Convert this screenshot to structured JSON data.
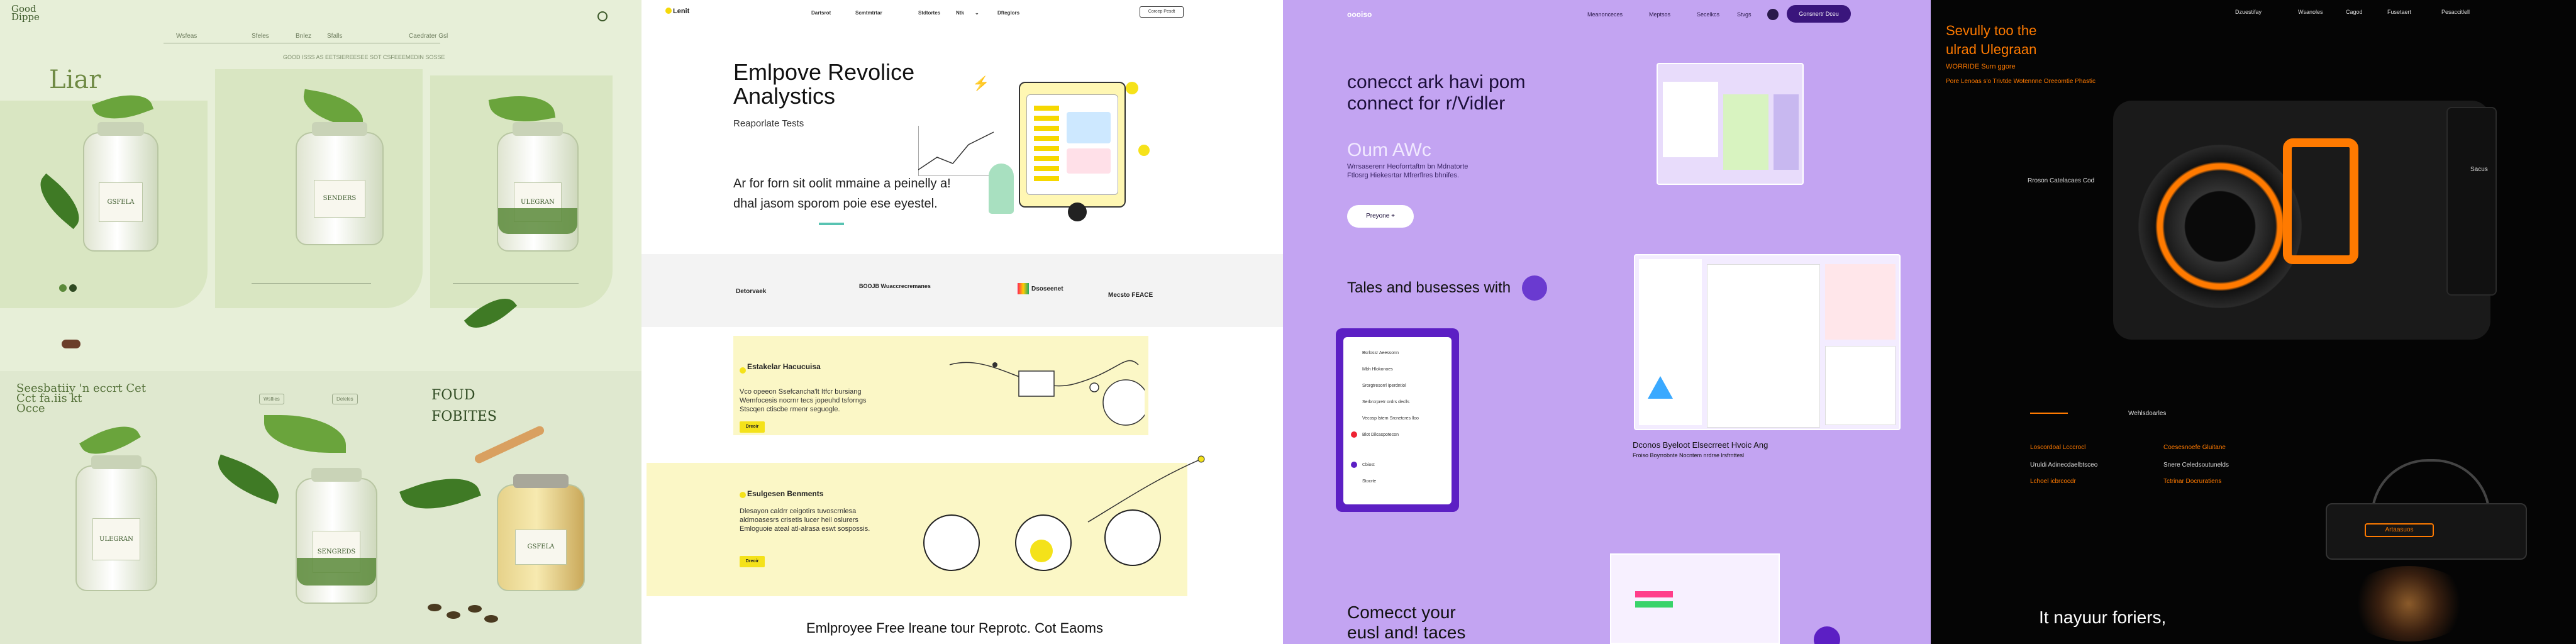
{
  "panel1": {
    "logo": [
      "Good",
      "Dippe"
    ],
    "nav": [
      "Wsfeas",
      "Sfeles",
      "Bnlez",
      "Sfalls",
      "Caedrater Gsl"
    ],
    "tagline": "GOOD ISSS AS EETSIEREESEE SOT CSFEEEMEDIN SOSSE",
    "hero_title": "Liar",
    "jar_labels": [
      "GSFELA",
      "SENDERS",
      "ULEGRAN",
      "SENGREDS"
    ],
    "mid_title": [
      "Seesbatiiy 'n eccrt Cet",
      "Cct fa.iis kt",
      "Occe"
    ],
    "found_title": [
      "FOUD",
      "FOBITES"
    ],
    "pills": [
      "Wsflies",
      "Deleles"
    ]
  },
  "panel2": {
    "brand": "Lenit",
    "nav": [
      "Dartsrot",
      "Scmtmtrtar",
      "Stdtortes",
      "Ntk",
      "Dfteglors"
    ],
    "nav_cta": "Corcep Pesdt",
    "hero_title": [
      "Emlpove Revolice",
      "Analystics"
    ],
    "hero_sub": "Reaporlate Tests",
    "hero_lead": [
      "Ar for forn sit oolit mmaine a peinelly a!",
      "dhal jasom sporom poie ese eyestel."
    ],
    "logos": [
      "Detorvaek",
      "BOOJB Wuaccrecremanes",
      "Dsoseenet",
      "Mecsto FEACE"
    ],
    "feature1": {
      "title": "Estakelar Hacucuisa",
      "text": [
        "Vco opeeon Ssefcancha'lt Itfcr bursiang",
        "Wemfocesis nocrnr tecs jopeuhd tsforngs",
        "Stscqen ctiscbe rmenr seguogle."
      ],
      "button": "Dreoir"
    },
    "feature2": {
      "title": "Esulgesen Benments",
      "text": [
        "Dlesayon caldrr ceigotirs tuvoscrnlesa",
        "aldmoasesrs crisetis lucer heil oslurers",
        "Emloguoie ateal atl-alrasa eswt sospossis."
      ],
      "button": "Dreoir"
    },
    "footer_title": "Emlproyee Free lreane tour Reprotc. Cot Eaoms"
  },
  "panel3": {
    "brand": "oooiso",
    "nav": [
      "Meanonceces",
      "Meptsos",
      "Secelkcs",
      "Stvgs"
    ],
    "cta": "Gonsnertr Dceu",
    "hero_title": [
      "conecct ark havi pom",
      "connect for r/Vidler"
    ],
    "hero_sub": "Oum AWc",
    "hero_small": [
      "Wrrsaserenr Heoforrtaftm bn Mdnatorte",
      "Ftlosrg Hiekesrtar Mfrerflres bhnifes."
    ],
    "hero_button": "Preyone +",
    "section_title": "Tales and busesses with",
    "phone_rows": [
      "Bsrlossr Aeessonn",
      "Mbh Hlokonoes",
      "Srorgtresorrl Iperdntiol",
      "Serbrcrpretr ordrs declls",
      "Vecosp lstem Srcnetcres lloo",
      "Blot Dilcaspotecon",
      "Cbiost",
      "Stocrte"
    ],
    "caption": [
      "Dconos Byeloot Elsecrreet Hvoic Ang",
      "Froiso Boyrrobnte Nocntem nrdrse lrsfrnttesl"
    ],
    "bottom_title": [
      "Comecct your",
      "eusl and! taces"
    ]
  },
  "panel4": {
    "title": [
      "Sevully too the",
      "ulrad Ulegraan"
    ],
    "sub_title": "WORRIDE Surn ggore",
    "sub_line": "Pore Lenoas s'o Trivtde Wotennne Oreeomtie Phastic",
    "nav": [
      "Dzuestifay",
      "Wsanoles",
      "Cagod",
      "Fusetaert",
      "Pesaccitlell"
    ],
    "label_left": "Rroson Catelacaes Cod",
    "label_right": "Sacus",
    "mid_label": "Wehlsdoarles",
    "col1_title": "Loscordoal Lcccrocl",
    "col1_lines": [
      "Uruldi Adinecdaelbtsceo",
      "Lchoel icbrcocdr"
    ],
    "col2_title": "Coesesnoefe Gluitane",
    "col2_lines": [
      "Snere Celedsoutunelds",
      "Tctrinar Docruratiens"
    ],
    "bottom_title": "It nayuur foriers,",
    "device_label": "Artaasuos"
  }
}
